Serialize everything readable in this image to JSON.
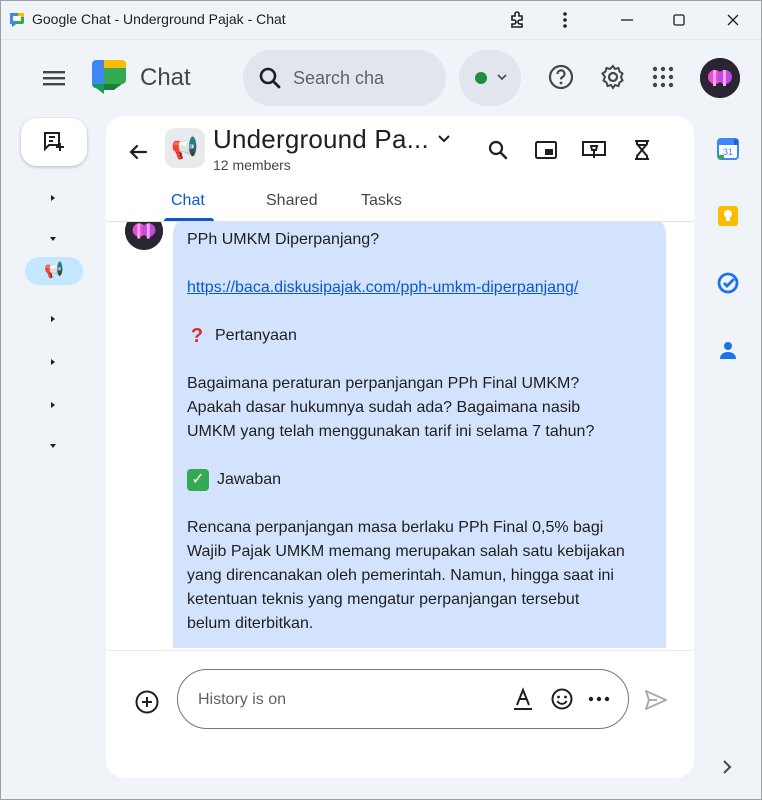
{
  "window": {
    "title": "Google Chat - Underground Pajak - Chat"
  },
  "appbar": {
    "app_name": "Chat",
    "search_placeholder": "Search cha",
    "status": "active"
  },
  "space": {
    "title": "Underground Pa...",
    "members": "12 members",
    "icon": "megaphone"
  },
  "tabs": [
    {
      "label": "Chat",
      "active": true
    },
    {
      "label": "Shared",
      "active": false
    },
    {
      "label": "Tasks",
      "active": false
    }
  ],
  "message": {
    "heading": "PPh UMKM Diperpanjang?",
    "link": "https://baca.diskusipajak.com/pph-umkm-diperpanjang/",
    "question_label": "Pertanyaan",
    "question_text": [
      "Bagaimana peraturan perpanjangan PPh Final UMKM?",
      "Apakah dasar hukumnya sudah ada? Bagaimana nasib",
      "UMKM yang telah menggunakan tarif ini selama 7 tahun?"
    ],
    "answer_label": "Jawaban",
    "answer_text": [
      "Rencana perpanjangan masa berlaku PPh Final 0,5% bagi",
      "Wajib Pajak UMKM memang merupakan salah satu kebijakan",
      "yang direncanakan oleh pemerintah. Namun, hingga saat ini",
      "ketentuan teknis yang mengatur perpanjangan tersebut",
      "belum diterbitkan."
    ]
  },
  "composer": {
    "placeholder": "History is on"
  },
  "colors": {
    "bubble": "#d3e3fd",
    "accent": "#0b57d0",
    "background": "#f0f4f9"
  }
}
